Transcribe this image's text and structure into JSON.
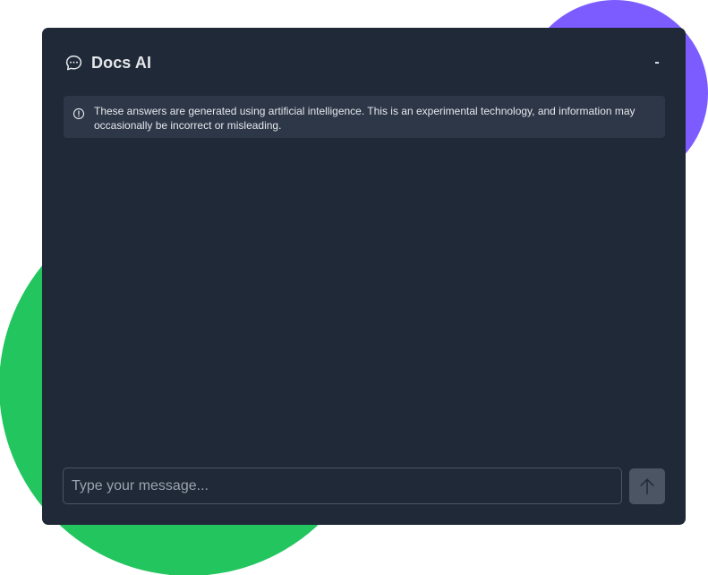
{
  "chat": {
    "title": "Docs AI",
    "minimize_label": "-",
    "disclaimer": "These answers are generated using artificial intelligence. This is an experimental technology, and information may occasionally be incorrect or misleading.",
    "input": {
      "placeholder": "Type your message...",
      "value": ""
    },
    "send_icon": "arrow-up-icon",
    "header_icon": "chat-bubble-icon",
    "info_icon": "info-circle-icon"
  },
  "colors": {
    "panel_background": "#1f2937",
    "disclaimer_background": "#2d3748",
    "green_blob": "#22c55e",
    "purple_blob": "#7c5cff",
    "send_button": "#4b5563",
    "text": "#e5e7eb"
  }
}
